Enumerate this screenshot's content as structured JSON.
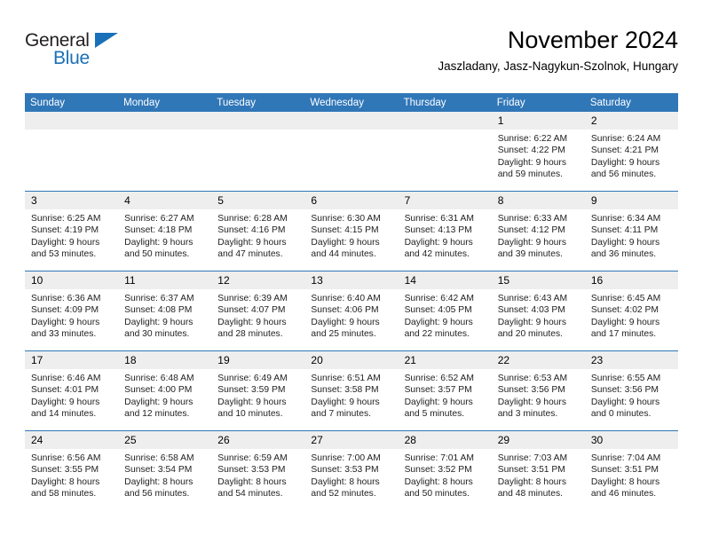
{
  "brand": {
    "name_part1": "General",
    "name_part2": "Blue",
    "triangle_color": "#1a70b8",
    "text_color": "#231f20"
  },
  "header": {
    "title": "November 2024",
    "subtitle": "Jaszladany, Jasz-Nagykun-Szolnok, Hungary"
  },
  "theme": {
    "header_blue": "#3077b8",
    "daynum_band": "#eeeeee",
    "row_divider": "#3077b8"
  },
  "calendar": {
    "weekday_headers": [
      "Sunday",
      "Monday",
      "Tuesday",
      "Wednesday",
      "Thursday",
      "Friday",
      "Saturday"
    ],
    "weeks": [
      [
        {
          "day": "",
          "empty": true,
          "sunrise": "",
          "sunset": "",
          "daylight_line1": "",
          "daylight_line2": ""
        },
        {
          "day": "",
          "empty": true,
          "sunrise": "",
          "sunset": "",
          "daylight_line1": "",
          "daylight_line2": ""
        },
        {
          "day": "",
          "empty": true,
          "sunrise": "",
          "sunset": "",
          "daylight_line1": "",
          "daylight_line2": ""
        },
        {
          "day": "",
          "empty": true,
          "sunrise": "",
          "sunset": "",
          "daylight_line1": "",
          "daylight_line2": ""
        },
        {
          "day": "",
          "empty": true,
          "sunrise": "",
          "sunset": "",
          "daylight_line1": "",
          "daylight_line2": ""
        },
        {
          "day": "1",
          "empty": false,
          "sunrise": "Sunrise: 6:22 AM",
          "sunset": "Sunset: 4:22 PM",
          "daylight_line1": "Daylight: 9 hours",
          "daylight_line2": "and 59 minutes."
        },
        {
          "day": "2",
          "empty": false,
          "sunrise": "Sunrise: 6:24 AM",
          "sunset": "Sunset: 4:21 PM",
          "daylight_line1": "Daylight: 9 hours",
          "daylight_line2": "and 56 minutes."
        }
      ],
      [
        {
          "day": "3",
          "empty": false,
          "sunrise": "Sunrise: 6:25 AM",
          "sunset": "Sunset: 4:19 PM",
          "daylight_line1": "Daylight: 9 hours",
          "daylight_line2": "and 53 minutes."
        },
        {
          "day": "4",
          "empty": false,
          "sunrise": "Sunrise: 6:27 AM",
          "sunset": "Sunset: 4:18 PM",
          "daylight_line1": "Daylight: 9 hours",
          "daylight_line2": "and 50 minutes."
        },
        {
          "day": "5",
          "empty": false,
          "sunrise": "Sunrise: 6:28 AM",
          "sunset": "Sunset: 4:16 PM",
          "daylight_line1": "Daylight: 9 hours",
          "daylight_line2": "and 47 minutes."
        },
        {
          "day": "6",
          "empty": false,
          "sunrise": "Sunrise: 6:30 AM",
          "sunset": "Sunset: 4:15 PM",
          "daylight_line1": "Daylight: 9 hours",
          "daylight_line2": "and 44 minutes."
        },
        {
          "day": "7",
          "empty": false,
          "sunrise": "Sunrise: 6:31 AM",
          "sunset": "Sunset: 4:13 PM",
          "daylight_line1": "Daylight: 9 hours",
          "daylight_line2": "and 42 minutes."
        },
        {
          "day": "8",
          "empty": false,
          "sunrise": "Sunrise: 6:33 AM",
          "sunset": "Sunset: 4:12 PM",
          "daylight_line1": "Daylight: 9 hours",
          "daylight_line2": "and 39 minutes."
        },
        {
          "day": "9",
          "empty": false,
          "sunrise": "Sunrise: 6:34 AM",
          "sunset": "Sunset: 4:11 PM",
          "daylight_line1": "Daylight: 9 hours",
          "daylight_line2": "and 36 minutes."
        }
      ],
      [
        {
          "day": "10",
          "empty": false,
          "sunrise": "Sunrise: 6:36 AM",
          "sunset": "Sunset: 4:09 PM",
          "daylight_line1": "Daylight: 9 hours",
          "daylight_line2": "and 33 minutes."
        },
        {
          "day": "11",
          "empty": false,
          "sunrise": "Sunrise: 6:37 AM",
          "sunset": "Sunset: 4:08 PM",
          "daylight_line1": "Daylight: 9 hours",
          "daylight_line2": "and 30 minutes."
        },
        {
          "day": "12",
          "empty": false,
          "sunrise": "Sunrise: 6:39 AM",
          "sunset": "Sunset: 4:07 PM",
          "daylight_line1": "Daylight: 9 hours",
          "daylight_line2": "and 28 minutes."
        },
        {
          "day": "13",
          "empty": false,
          "sunrise": "Sunrise: 6:40 AM",
          "sunset": "Sunset: 4:06 PM",
          "daylight_line1": "Daylight: 9 hours",
          "daylight_line2": "and 25 minutes."
        },
        {
          "day": "14",
          "empty": false,
          "sunrise": "Sunrise: 6:42 AM",
          "sunset": "Sunset: 4:05 PM",
          "daylight_line1": "Daylight: 9 hours",
          "daylight_line2": "and 22 minutes."
        },
        {
          "day": "15",
          "empty": false,
          "sunrise": "Sunrise: 6:43 AM",
          "sunset": "Sunset: 4:03 PM",
          "daylight_line1": "Daylight: 9 hours",
          "daylight_line2": "and 20 minutes."
        },
        {
          "day": "16",
          "empty": false,
          "sunrise": "Sunrise: 6:45 AM",
          "sunset": "Sunset: 4:02 PM",
          "daylight_line1": "Daylight: 9 hours",
          "daylight_line2": "and 17 minutes."
        }
      ],
      [
        {
          "day": "17",
          "empty": false,
          "sunrise": "Sunrise: 6:46 AM",
          "sunset": "Sunset: 4:01 PM",
          "daylight_line1": "Daylight: 9 hours",
          "daylight_line2": "and 14 minutes."
        },
        {
          "day": "18",
          "empty": false,
          "sunrise": "Sunrise: 6:48 AM",
          "sunset": "Sunset: 4:00 PM",
          "daylight_line1": "Daylight: 9 hours",
          "daylight_line2": "and 12 minutes."
        },
        {
          "day": "19",
          "empty": false,
          "sunrise": "Sunrise: 6:49 AM",
          "sunset": "Sunset: 3:59 PM",
          "daylight_line1": "Daylight: 9 hours",
          "daylight_line2": "and 10 minutes."
        },
        {
          "day": "20",
          "empty": false,
          "sunrise": "Sunrise: 6:51 AM",
          "sunset": "Sunset: 3:58 PM",
          "daylight_line1": "Daylight: 9 hours",
          "daylight_line2": "and 7 minutes."
        },
        {
          "day": "21",
          "empty": false,
          "sunrise": "Sunrise: 6:52 AM",
          "sunset": "Sunset: 3:57 PM",
          "daylight_line1": "Daylight: 9 hours",
          "daylight_line2": "and 5 minutes."
        },
        {
          "day": "22",
          "empty": false,
          "sunrise": "Sunrise: 6:53 AM",
          "sunset": "Sunset: 3:56 PM",
          "daylight_line1": "Daylight: 9 hours",
          "daylight_line2": "and 3 minutes."
        },
        {
          "day": "23",
          "empty": false,
          "sunrise": "Sunrise: 6:55 AM",
          "sunset": "Sunset: 3:56 PM",
          "daylight_line1": "Daylight: 9 hours",
          "daylight_line2": "and 0 minutes."
        }
      ],
      [
        {
          "day": "24",
          "empty": false,
          "sunrise": "Sunrise: 6:56 AM",
          "sunset": "Sunset: 3:55 PM",
          "daylight_line1": "Daylight: 8 hours",
          "daylight_line2": "and 58 minutes."
        },
        {
          "day": "25",
          "empty": false,
          "sunrise": "Sunrise: 6:58 AM",
          "sunset": "Sunset: 3:54 PM",
          "daylight_line1": "Daylight: 8 hours",
          "daylight_line2": "and 56 minutes."
        },
        {
          "day": "26",
          "empty": false,
          "sunrise": "Sunrise: 6:59 AM",
          "sunset": "Sunset: 3:53 PM",
          "daylight_line1": "Daylight: 8 hours",
          "daylight_line2": "and 54 minutes."
        },
        {
          "day": "27",
          "empty": false,
          "sunrise": "Sunrise: 7:00 AM",
          "sunset": "Sunset: 3:53 PM",
          "daylight_line1": "Daylight: 8 hours",
          "daylight_line2": "and 52 minutes."
        },
        {
          "day": "28",
          "empty": false,
          "sunrise": "Sunrise: 7:01 AM",
          "sunset": "Sunset: 3:52 PM",
          "daylight_line1": "Daylight: 8 hours",
          "daylight_line2": "and 50 minutes."
        },
        {
          "day": "29",
          "empty": false,
          "sunrise": "Sunrise: 7:03 AM",
          "sunset": "Sunset: 3:51 PM",
          "daylight_line1": "Daylight: 8 hours",
          "daylight_line2": "and 48 minutes."
        },
        {
          "day": "30",
          "empty": false,
          "sunrise": "Sunrise: 7:04 AM",
          "sunset": "Sunset: 3:51 PM",
          "daylight_line1": "Daylight: 8 hours",
          "daylight_line2": "and 46 minutes."
        }
      ]
    ]
  }
}
